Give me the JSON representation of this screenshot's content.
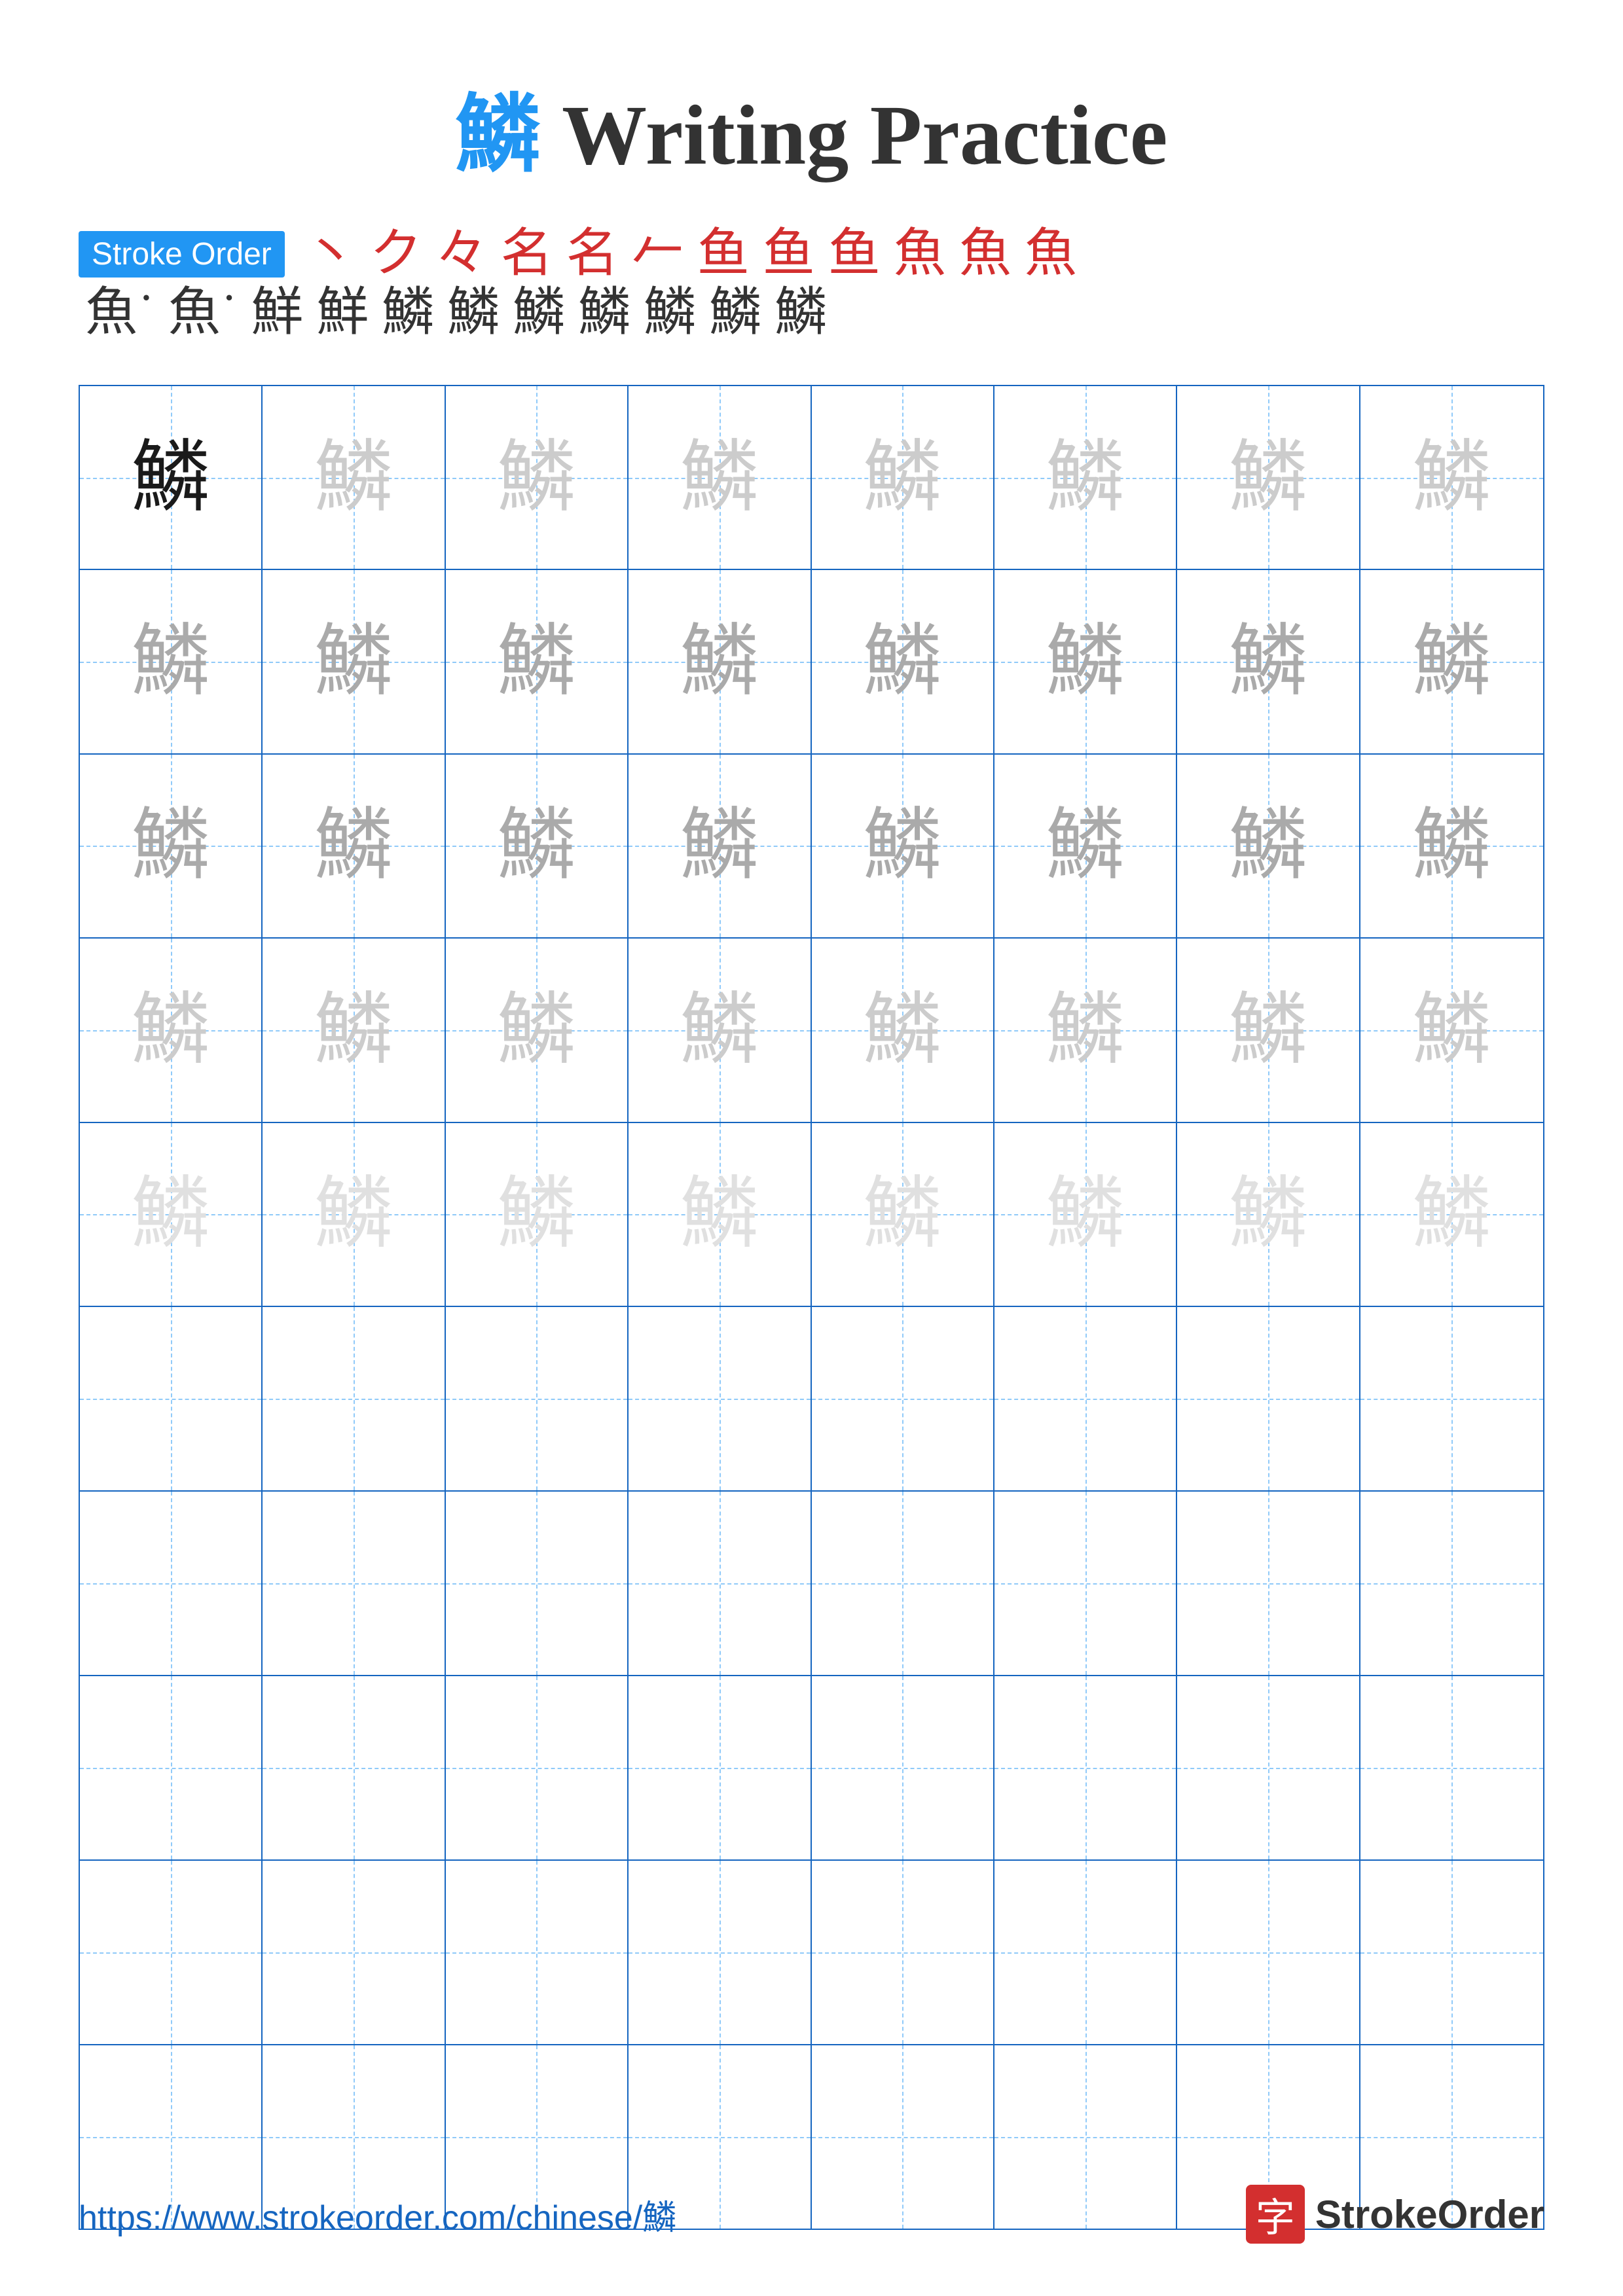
{
  "title": {
    "char": "鱗",
    "suffix": " Writing Practice"
  },
  "stroke_order": {
    "badge_label": "Stroke Order",
    "row1_chars": [
      "丶",
      "ク",
      "々",
      "名",
      "名",
      "𩵁",
      "𩵂",
      "魚",
      "魚",
      "魚",
      "魚"
    ],
    "row2_chars": [
      "魚˙",
      "魚˙˙",
      "鮮",
      "鮮˙",
      "鱗˙",
      "鱗˙˙",
      "鱗˙˙˙",
      "鱗˙˙˙˙",
      "鱗˙˙˙˙˙",
      "鱗˙˙˙˙˙˙",
      "鱗"
    ]
  },
  "grid": {
    "cols": 8,
    "char": "鱗",
    "rows": [
      {
        "type": "dark-fade",
        "cells": [
          "dark",
          "light",
          "light",
          "light",
          "light",
          "light",
          "light",
          "light"
        ]
      },
      {
        "type": "medium-fade",
        "cells": [
          "medium",
          "medium",
          "medium",
          "medium",
          "medium",
          "medium",
          "medium",
          "medium"
        ]
      },
      {
        "type": "medium-fade",
        "cells": [
          "medium",
          "medium",
          "medium",
          "medium",
          "medium",
          "medium",
          "medium",
          "medium"
        ]
      },
      {
        "type": "light-fade",
        "cells": [
          "light",
          "light",
          "light",
          "light",
          "light",
          "light",
          "light",
          "light"
        ]
      },
      {
        "type": "very-light-fade",
        "cells": [
          "very-light",
          "very-light",
          "very-light",
          "very-light",
          "very-light",
          "very-light",
          "very-light",
          "very-light"
        ]
      },
      {
        "type": "empty",
        "cells": [
          "",
          "",
          "",
          "",
          "",
          "",
          "",
          ""
        ]
      },
      {
        "type": "empty",
        "cells": [
          "",
          "",
          "",
          "",
          "",
          "",
          "",
          ""
        ]
      },
      {
        "type": "empty",
        "cells": [
          "",
          "",
          "",
          "",
          "",
          "",
          "",
          ""
        ]
      },
      {
        "type": "empty",
        "cells": [
          "",
          "",
          "",
          "",
          "",
          "",
          "",
          ""
        ]
      },
      {
        "type": "empty",
        "cells": [
          "",
          "",
          "",
          "",
          "",
          "",
          "",
          ""
        ]
      }
    ]
  },
  "footer": {
    "url": "https://www.strokeorder.com/chinese/鱗",
    "logo_text": "StrokeOrder",
    "logo_icon": "字"
  }
}
